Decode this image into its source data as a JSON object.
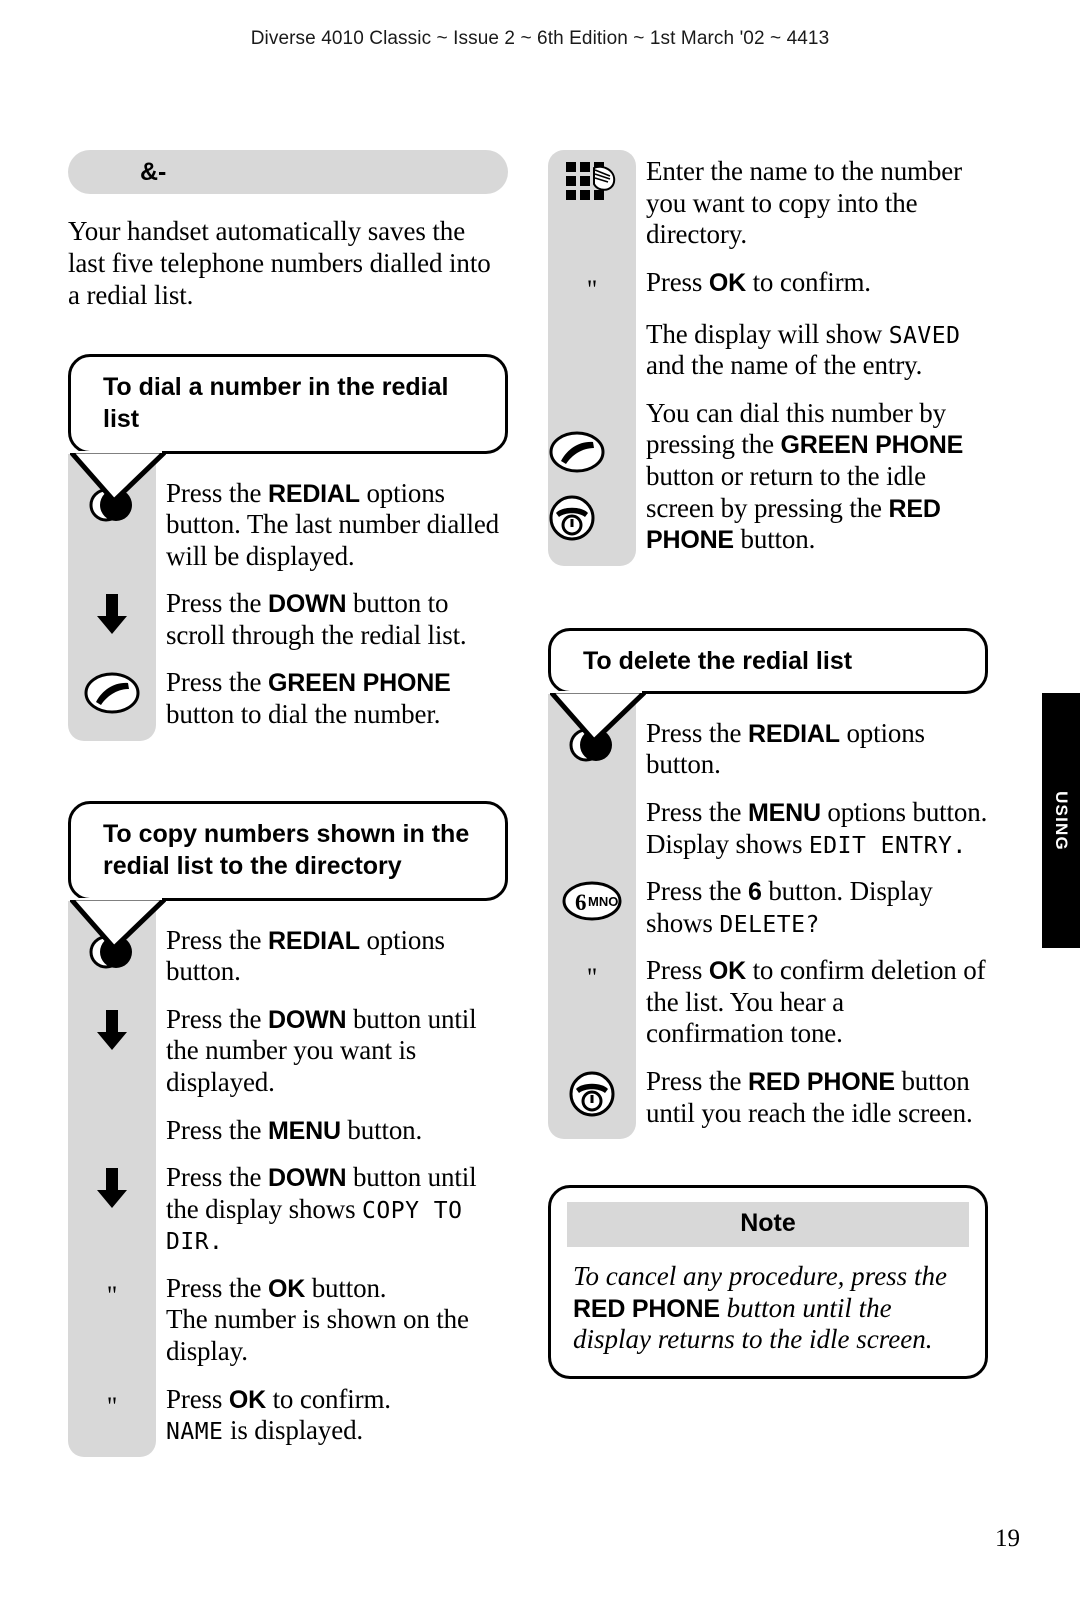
{
  "page": {
    "running_head": "Diverse 4010 Classic ~ Issue 2 ~ 6th Edition ~ 1st March '02 ~ 4413",
    "folio": "19",
    "thumb_tab": "USING"
  },
  "section": {
    "title": "&-",
    "intro": "Your handset automatically saves the last five telephone numbers dialled into a redial list."
  },
  "callouts": {
    "dial": "To dial a number in the redial list",
    "copy": "To copy numbers shown in the redial list to the directory",
    "delete": "To delete the redial list"
  },
  "steps_dial": [
    {
      "icon": "redial-icon",
      "parts": [
        {
          "t": "plain",
          "v": "Press the "
        },
        {
          "t": "key",
          "v": "REDIAL"
        },
        {
          "t": "plain",
          "v": " options button. The last number dialled will be displayed."
        }
      ]
    },
    {
      "icon": "down-arrow-icon",
      "parts": [
        {
          "t": "plain",
          "v": "Press the "
        },
        {
          "t": "key",
          "v": "DOWN"
        },
        {
          "t": "plain",
          "v": " button to scroll through the redial list."
        }
      ]
    },
    {
      "icon": "green-phone-icon",
      "parts": [
        {
          "t": "plain",
          "v": "Press the "
        },
        {
          "t": "key",
          "v": "GREEN PHONE"
        },
        {
          "t": "plain",
          "v": " button to dial the number."
        }
      ]
    }
  ],
  "steps_copy": [
    {
      "icon": "redial-icon",
      "parts": [
        {
          "t": "plain",
          "v": "Press the "
        },
        {
          "t": "key",
          "v": "REDIAL"
        },
        {
          "t": "plain",
          "v": " options button."
        }
      ]
    },
    {
      "icon": "down-arrow-icon",
      "parts": [
        {
          "t": "plain",
          "v": "Press the "
        },
        {
          "t": "key",
          "v": "DOWN"
        },
        {
          "t": "plain",
          "v": " button until the number you want is displayed."
        }
      ]
    },
    {
      "icon": "none",
      "parts": [
        {
          "t": "plain",
          "v": "Press the "
        },
        {
          "t": "key",
          "v": "MENU"
        },
        {
          "t": "plain",
          "v": " button."
        }
      ]
    },
    {
      "icon": "down-arrow-icon",
      "parts": [
        {
          "t": "plain",
          "v": "Press the "
        },
        {
          "t": "key",
          "v": "DOWN"
        },
        {
          "t": "plain",
          "v": " button until the display shows "
        },
        {
          "t": "lcd",
          "v": "COPY TO DIR."
        }
      ]
    },
    {
      "icon": "ok-key-icon",
      "parts": [
        {
          "t": "plain",
          "v": "Press the "
        },
        {
          "t": "key",
          "v": "OK"
        },
        {
          "t": "plain",
          "v": " button."
        },
        {
          "t": "br",
          "v": ""
        },
        {
          "t": "plain",
          "v": "The number is shown on the display."
        }
      ]
    },
    {
      "icon": "ok-key-icon",
      "parts": [
        {
          "t": "plain",
          "v": "Press "
        },
        {
          "t": "key",
          "v": "OK"
        },
        {
          "t": "plain",
          "v": " to confirm."
        },
        {
          "t": "br",
          "v": ""
        },
        {
          "t": "lcd",
          "v": "NAME"
        },
        {
          "t": "plain",
          "v": " is displayed."
        }
      ]
    }
  ],
  "steps_copy_cont": [
    {
      "icon": "keypad-icon",
      "parts": [
        {
          "t": "plain",
          "v": "Enter the name to the number you want to copy into the directory."
        }
      ]
    },
    {
      "icon": "ok-key-icon",
      "parts": [
        {
          "t": "plain",
          "v": "Press "
        },
        {
          "t": "key",
          "v": "OK"
        },
        {
          "t": "plain",
          "v": " to confirm."
        }
      ]
    },
    {
      "icon": "none",
      "parts": [
        {
          "t": "plain",
          "v": "The display will show "
        },
        {
          "t": "lcd",
          "v": "SAVED"
        },
        {
          "t": "plain",
          "v": " and the name of the entry."
        }
      ]
    },
    {
      "icon": "green-red-phone-icons",
      "parts": [
        {
          "t": "plain",
          "v": "You can dial this number by pressing the "
        },
        {
          "t": "key",
          "v": "GREEN PHONE"
        },
        {
          "t": "plain",
          "v": " button or return to the idle screen by pressing the "
        },
        {
          "t": "key",
          "v": "RED PHONE"
        },
        {
          "t": "plain",
          "v": " button."
        }
      ]
    }
  ],
  "steps_delete": [
    {
      "icon": "redial-icon",
      "parts": [
        {
          "t": "plain",
          "v": "Press the "
        },
        {
          "t": "key",
          "v": "REDIAL"
        },
        {
          "t": "plain",
          "v": " options button."
        }
      ]
    },
    {
      "icon": "none",
      "parts": [
        {
          "t": "plain",
          "v": "Press the "
        },
        {
          "t": "key",
          "v": "MENU"
        },
        {
          "t": "plain",
          "v": " options button. Display shows "
        },
        {
          "t": "lcd",
          "v": "EDIT ENTRY."
        }
      ]
    },
    {
      "icon": "key-6-mno-icon",
      "parts": [
        {
          "t": "plain",
          "v": "Press the "
        },
        {
          "t": "key",
          "v": "6"
        },
        {
          "t": "plain",
          "v": " button. Display shows "
        },
        {
          "t": "lcd",
          "v": "DELETE?"
        }
      ]
    },
    {
      "icon": "ok-key-icon",
      "parts": [
        {
          "t": "plain",
          "v": "Press "
        },
        {
          "t": "key",
          "v": "OK"
        },
        {
          "t": "plain",
          "v": " to confirm deletion of the list. You hear a confirmation tone."
        }
      ]
    },
    {
      "icon": "red-phone-icon",
      "parts": [
        {
          "t": "plain",
          "v": "Press the "
        },
        {
          "t": "key",
          "v": "RED PHONE"
        },
        {
          "t": "plain",
          "v": " button until you reach the idle screen."
        }
      ]
    }
  ],
  "note": {
    "heading": "Note",
    "parts": [
      {
        "t": "plain",
        "v": "To cancel any procedure, press the "
      },
      {
        "t": "key",
        "v": "RED PHONE"
      },
      {
        "t": "plain",
        "v": " button until the display returns to the idle screen."
      }
    ]
  },
  "icons": {
    "ok_mark": "\""
  }
}
